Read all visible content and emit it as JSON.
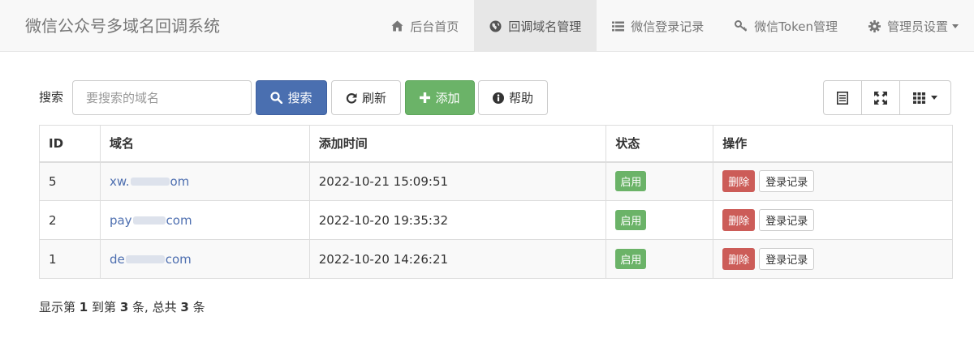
{
  "brand": "微信公众号多域名回调系统",
  "nav": [
    {
      "label": "后台首页",
      "icon": "home-icon"
    },
    {
      "label": "回调域名管理",
      "icon": "globe-icon",
      "active": true
    },
    {
      "label": "微信登录记录",
      "icon": "list-icon"
    },
    {
      "label": "微信Token管理",
      "icon": "key-icon"
    },
    {
      "label": "管理员设置",
      "icon": "gear-icon",
      "dropdown": true
    }
  ],
  "toolbar": {
    "search_label": "搜索",
    "search_placeholder": "要搜索的域名",
    "search_button": "搜索",
    "refresh_button": "刷新",
    "add_button": "添加",
    "help_button": "帮助"
  },
  "table": {
    "columns": [
      "ID",
      "域名",
      "添加时间",
      "状态",
      "操作"
    ],
    "rows": [
      {
        "id": "5",
        "domain_prefix": "xw.",
        "domain_suffix": "om",
        "added": "2022-10-21 15:09:51",
        "status": "启用"
      },
      {
        "id": "2",
        "domain_prefix": "pay",
        "domain_suffix": "com",
        "added": "2022-10-20 19:35:32",
        "status": "启用"
      },
      {
        "id": "1",
        "domain_prefix": "de",
        "domain_suffix": "com",
        "added": "2022-10-20 14:26:21",
        "status": "启用"
      }
    ],
    "delete_label": "删除",
    "log_label": "登录记录"
  },
  "pagination": {
    "prefix": "显示第",
    "from": "1",
    "to_word": "到第",
    "to": "3",
    "mid": "条, 总共",
    "total": "3",
    "suffix": "条"
  },
  "colors": {
    "primary": "#4a6fb0",
    "success": "#6bb368",
    "danger": "#cc5c58",
    "link": "#4e6fb0"
  }
}
